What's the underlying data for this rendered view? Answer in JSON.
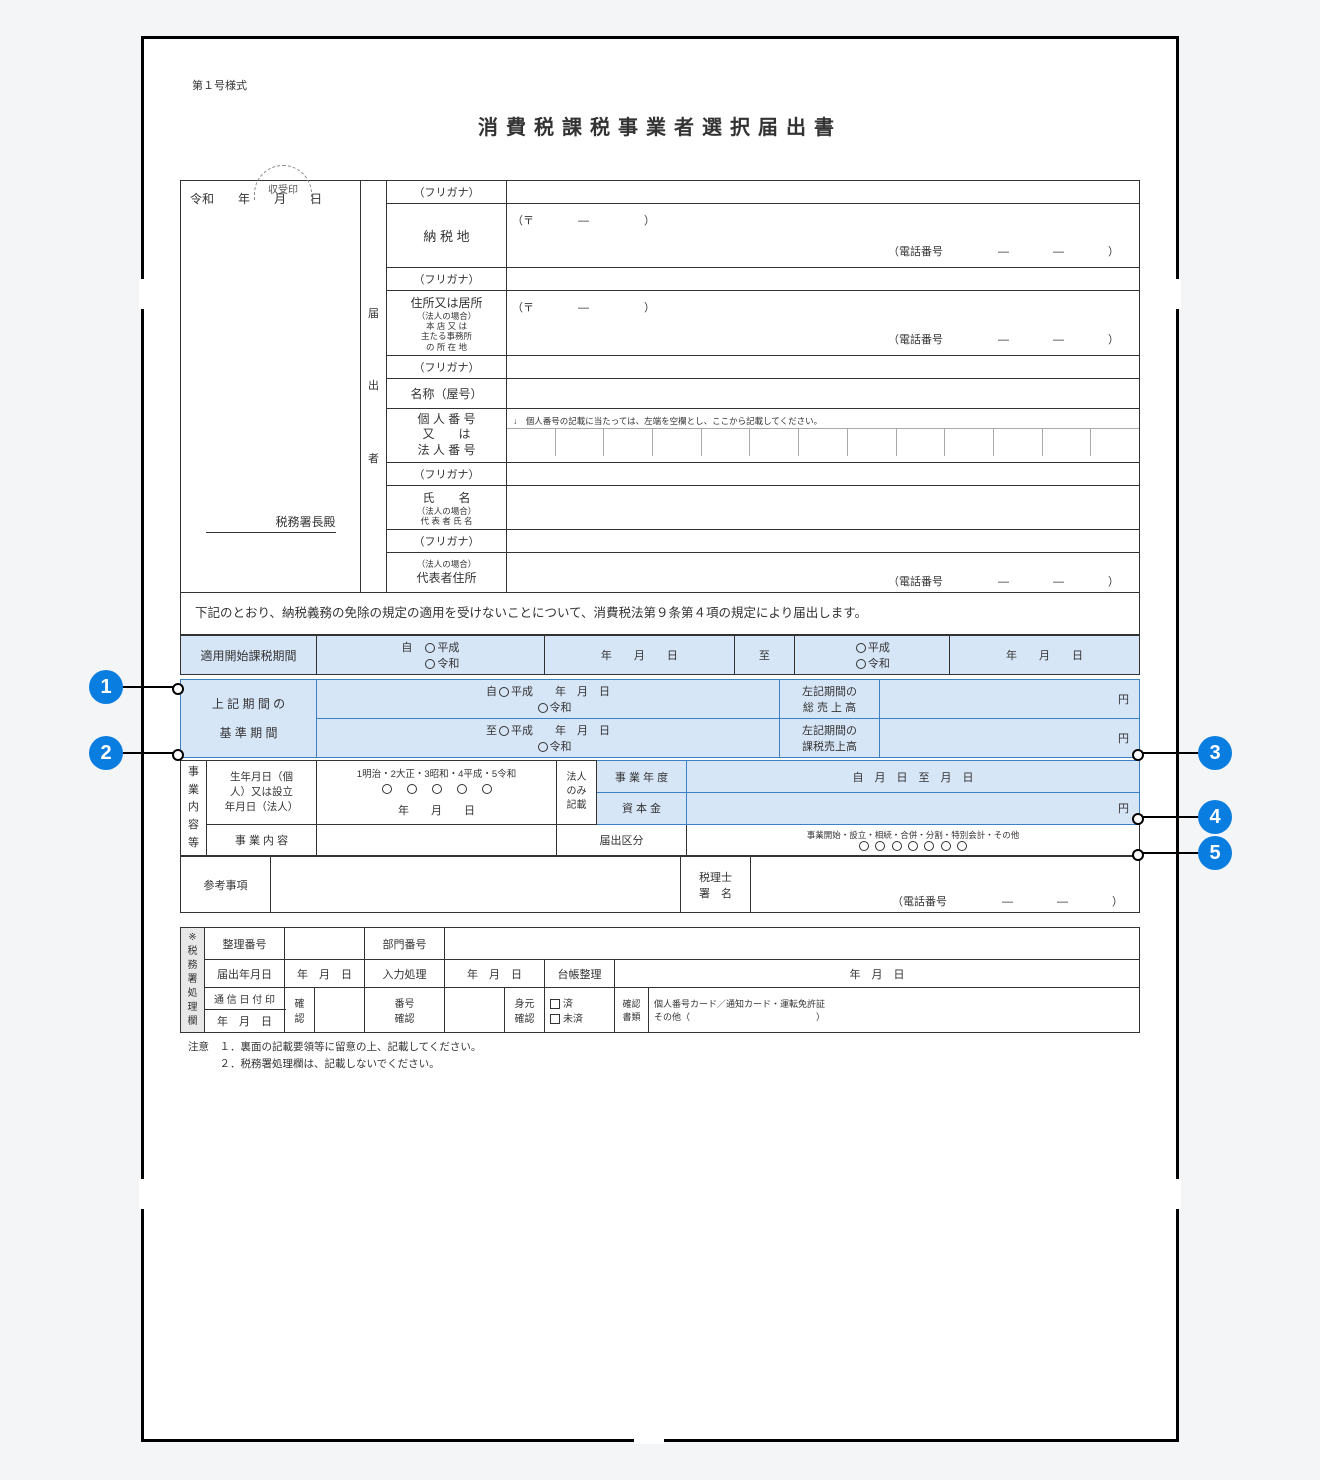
{
  "formNumber": "第１号様式",
  "title": "消費税課税事業者選択届出書",
  "stamp": "収受印",
  "dateLine": {
    "era": "令和",
    "y": "年",
    "m": "月",
    "d": "日"
  },
  "filer": {
    "vert": [
      "届",
      "出",
      "者"
    ]
  },
  "rows": {
    "furigana": "（フリガナ）",
    "nouzei": "納 税 地",
    "postal": "（〒　　　　―　　　　　）",
    "tel": "（電話番号　　　　　―　　　　―　　　　）",
    "jusho": "住所又は居所",
    "jushoSub": "（法人の場合）\n本 店 又 は\n主たる事務所\nの 所 在 地",
    "meisho": "名称（屋号）",
    "bango": "個 人 番 号\n又　　は\n法 人 番 号",
    "bangoNote": "↓　個人番号の記載に当たっては、左端を空欄とし、ここから記載してください。",
    "shimei": "氏　　名",
    "shimeiSub": "（法人の場合）\n代 表 者 氏 名",
    "daihyoJusho": "代表者住所",
    "daihyoSub": "（法人の場合）"
  },
  "office": "税務署長殿",
  "statement": "下記のとおり、納税義務の免除の規定の適用を受けないことについて、消費税法第９条第４項の規定により届出します。",
  "sec1": {
    "label": "適用開始課税期間",
    "from": "自",
    "heisei": "平成",
    "reiwa": "令和",
    "y": "年",
    "m": "月",
    "d": "日",
    "to": "至"
  },
  "sec2": {
    "label1": "上 記 期 間 の",
    "label2": "基 準 期 間",
    "sales1": "左記期間の\n総 売 上 高",
    "sales2": "左記期間の\n課税売上高",
    "yen": "円"
  },
  "sec3": {
    "vert": "事業内容等",
    "birth": "生年月日（個\n人）又は設立\n年月日（法人）",
    "eraOpts": "1明治・2大正・3昭和・4平成・5令和",
    "houjin": "法人\nのみ\n記載",
    "nendo": "事 業 年 度",
    "nendoVal": "自　月　日　至　月　日",
    "shihon": "資 本 金",
    "yen": "円",
    "naiyo": "事 業 内 容",
    "kubun": "届出区分",
    "kubunOpts": "事業開始・設立・相続・合併・分割・特別会計・その他"
  },
  "ref": {
    "sankou": "参考事項",
    "zeirishi": "税理士\n署　名"
  },
  "shori": {
    "vert": "※税務署処理欄",
    "seiri": "整理番号",
    "bumon": "部門番号",
    "todoke": "届出年月日",
    "nyuryoku": "入力処理",
    "daicho": "台帳整理",
    "tsushin": "通 信 日 付 印",
    "kakunin": "確認",
    "bangoK": "番号\n確認",
    "mimoto": "身元\n確認",
    "sumi": "済",
    "mizumi": "未済",
    "shorui": "確認\n書類",
    "shoruiVal": "個人番号カード／通知カード・運転免許証\nその他（　　　　　　　　　　　　　　）"
  },
  "notes": {
    "head": "注意",
    "n1": "１．裏面の記載要領等に留意の上、記載してください。",
    "n2": "２．税務署処理欄は、記載しないでください。"
  },
  "callouts": [
    "1",
    "2",
    "3",
    "4",
    "5"
  ]
}
